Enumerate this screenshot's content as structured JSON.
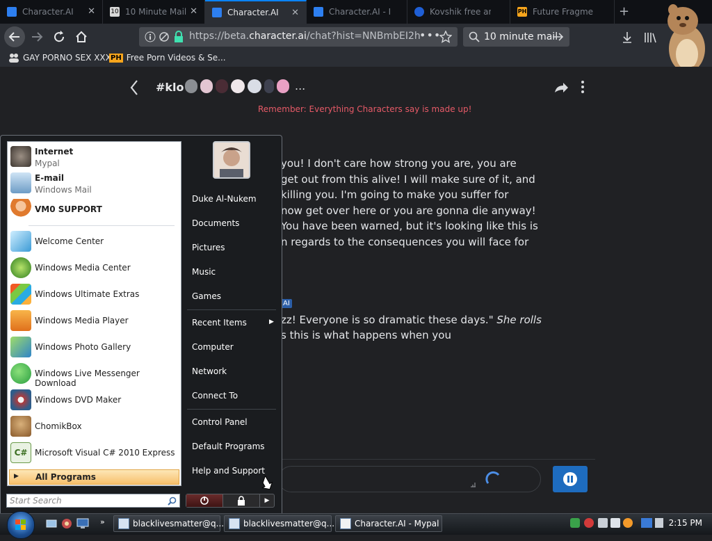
{
  "tabs": [
    {
      "label": "Character.AI",
      "icon": "character-ai-icon",
      "active": false
    },
    {
      "label": "10 Minute Mail",
      "icon": "ten-minute-mail-icon",
      "active": false
    },
    {
      "label": "Character.AI",
      "icon": "character-ai-icon",
      "active": true
    },
    {
      "label": "Character.AI - M",
      "icon": "character-ai-icon",
      "active": false
    },
    {
      "label": "Kovshik free an",
      "icon": "kovshik-icon",
      "active": false
    },
    {
      "label": "Future Fragmen",
      "icon": "ph-icon",
      "active": false
    }
  ],
  "tab_close": "✕",
  "new_tab": "+",
  "url": {
    "prefix": "https://beta.",
    "domain": "character.ai",
    "path": "/chat?hist=NNBmbEI2h"
  },
  "search_value": "10 minute mail",
  "bookmarks": [
    {
      "label": "GAY PORNO SEX XXX"
    },
    {
      "badge": "PH",
      "label": "Free Porn Videos & Se..."
    }
  ],
  "chat": {
    "title": "#klo",
    "more": "...",
    "warning": "Remember: Everything Characters say is made up!",
    "message1": [
      "you! I don't care how strong you are, you are",
      "get out from this alive! I will make sure of it, and",
      "killing you. I'm going to make you suffer for",
      "now get over here or you are gonna die anyway!",
      "You have been warned, but it's looking like this is",
      "n regards to the consequences you will face for"
    ],
    "ai_badge": "AI",
    "message2_a": "zz! Everyone is so dramatic these days.\"",
    "message2_italic": "She rolls",
    "message2_b": "s this is what happens when you"
  },
  "start_menu": {
    "pinned": [
      {
        "title": "Internet",
        "sub": "Mypal",
        "icon": "raccoon-browser-icon"
      },
      {
        "title": "E-mail",
        "sub": "Windows Mail",
        "icon": "mail-icon"
      },
      {
        "title": "VM0 SUPPORT",
        "sub": "",
        "icon": "support-user-icon"
      }
    ],
    "recent": [
      {
        "title": "Welcome Center",
        "icon": "welcome-center-icon"
      },
      {
        "title": "Windows Media Center",
        "icon": "media-center-icon"
      },
      {
        "title": "Windows Ultimate Extras",
        "icon": "ultimate-extras-icon"
      },
      {
        "title": "Windows Media Player",
        "icon": "media-player-icon"
      },
      {
        "title": "Windows Photo Gallery",
        "icon": "photo-gallery-icon"
      },
      {
        "title": "Windows Live Messenger Download",
        "icon": "messenger-icon"
      },
      {
        "title": "Windows DVD Maker",
        "icon": "dvd-maker-icon"
      },
      {
        "title": "ChomikBox",
        "icon": "chomikbox-icon"
      },
      {
        "title": "Microsoft Visual C# 2010 Express",
        "icon": "visual-csharp-icon"
      }
    ],
    "all_programs": "All Programs",
    "search_placeholder": "Start Search",
    "right_items": [
      "Duke Al-Nukem",
      "Documents",
      "Pictures",
      "Music",
      "Games"
    ],
    "right_items2": [
      "Recent Items",
      "Computer",
      "Network",
      "Connect To"
    ],
    "right_items3": [
      "Control Panel",
      "Default Programs",
      "Help and Support"
    ]
  },
  "taskbar": {
    "buttons": [
      {
        "label": "blacklivesmatter@q..."
      },
      {
        "label": "blacklivesmatter@q..."
      },
      {
        "label": "Character.AI - Mypal"
      }
    ],
    "clock": "2:15 PM"
  }
}
